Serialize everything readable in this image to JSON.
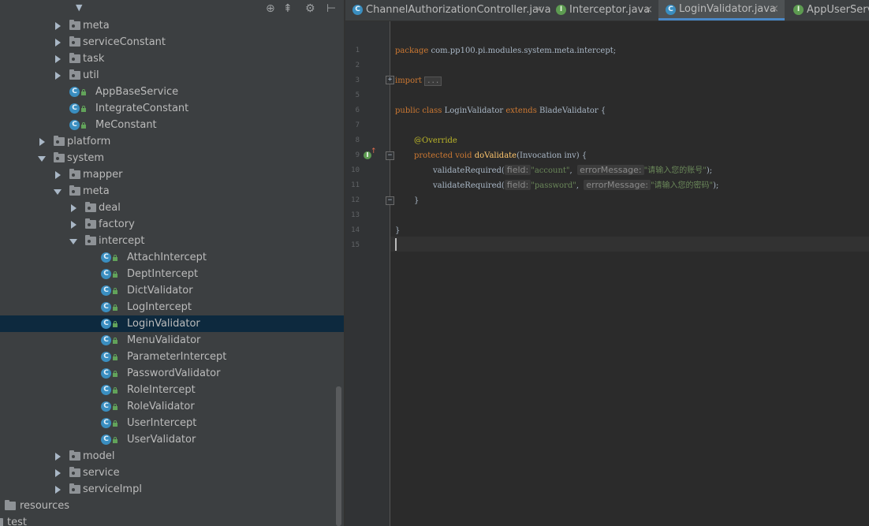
{
  "project_tree": {
    "rows": [
      {
        "label": "meta",
        "kind": "package",
        "expanded": false
      },
      {
        "label": "serviceConstant",
        "kind": "package",
        "expanded": false
      },
      {
        "label": "task",
        "kind": "package",
        "expanded": false
      },
      {
        "label": "util",
        "kind": "package",
        "expanded": false
      },
      {
        "label": "AppBaseService",
        "kind": "class"
      },
      {
        "label": "IntegrateConstant",
        "kind": "class"
      },
      {
        "label": "MeConstant",
        "kind": "class"
      },
      {
        "label": "platform",
        "kind": "package",
        "expanded": false
      },
      {
        "label": "system",
        "kind": "package",
        "expanded": true
      },
      {
        "label": "mapper",
        "kind": "package",
        "expanded": false
      },
      {
        "label": "meta",
        "kind": "package",
        "expanded": true
      },
      {
        "label": "deal",
        "kind": "package",
        "expanded": false
      },
      {
        "label": "factory",
        "kind": "package",
        "expanded": false
      },
      {
        "label": "intercept",
        "kind": "package",
        "expanded": true
      },
      {
        "label": "AttachIntercept",
        "kind": "class"
      },
      {
        "label": "DeptIntercept",
        "kind": "class"
      },
      {
        "label": "DictValidator",
        "kind": "class"
      },
      {
        "label": "LogIntercept",
        "kind": "class"
      },
      {
        "label": "LoginValidator",
        "kind": "class",
        "selected": true
      },
      {
        "label": "MenuValidator",
        "kind": "class"
      },
      {
        "label": "ParameterIntercept",
        "kind": "class"
      },
      {
        "label": "PasswordValidator",
        "kind": "class"
      },
      {
        "label": "RoleIntercept",
        "kind": "class"
      },
      {
        "label": "RoleValidator",
        "kind": "class"
      },
      {
        "label": "UserIntercept",
        "kind": "class"
      },
      {
        "label": "UserValidator",
        "kind": "class"
      },
      {
        "label": "model",
        "kind": "package",
        "expanded": false
      },
      {
        "label": "service",
        "kind": "package",
        "expanded": false
      },
      {
        "label": "serviceImpl",
        "kind": "package",
        "expanded": false
      },
      {
        "label": "resources",
        "kind": "folder"
      },
      {
        "label": "test",
        "kind": "folder"
      }
    ]
  },
  "editor": {
    "tabs": [
      {
        "label": "ChannelAuthorizationController.java",
        "icon": "class-icon",
        "active": false
      },
      {
        "label": "Interceptor.java",
        "icon": "interface-icon",
        "active": false
      },
      {
        "label": "LoginValidator.java",
        "icon": "class-icon",
        "active": true
      },
      {
        "label": "AppUserServi",
        "icon": "interface-icon",
        "active": false
      }
    ],
    "close_glyph": "×",
    "line_numbers": [
      "1",
      "2",
      "3",
      "5",
      "6",
      "7",
      "8",
      "9",
      "10",
      "11",
      "12",
      "13",
      "14",
      "15"
    ],
    "code": {
      "l1_kw": "package",
      "l1_rest": " com.pp100.pi.modules.system.meta.intercept;",
      "l3_kw": "import",
      "l3_fold": "...",
      "l6_kw1": "public class",
      "l6_name": " LoginValidator ",
      "l6_kw2": "extends",
      "l6_rest": " BladeValidator {",
      "l8_ann": "@Override",
      "l9_kw": "protected void",
      "l9_fn": "doValidate",
      "l9_rest": "(Invocation inv) {",
      "l10_call": "validateRequired(",
      "l10_hint1": "field:",
      "l10_str1": "\"account\"",
      "l10_hint2": "errorMessage:",
      "l10_str2": "\"请输入您的账号\"",
      "l10_end": ");",
      "l11_call": "validateRequired(",
      "l11_hint1": "field:",
      "l11_str1": "\"password\"",
      "l11_hint2": "errorMessage:",
      "l11_str2": "\"请输入您的密码\"",
      "l11_end": ");",
      "l12_brace": "}",
      "l14_brace": "}"
    }
  },
  "colors": {
    "selection": "#0d293e",
    "keyword": "#cc7832",
    "string": "#6a8759",
    "annotation": "#bbb529",
    "method": "#ffc66d",
    "tab_underline": "#4a88c7"
  }
}
